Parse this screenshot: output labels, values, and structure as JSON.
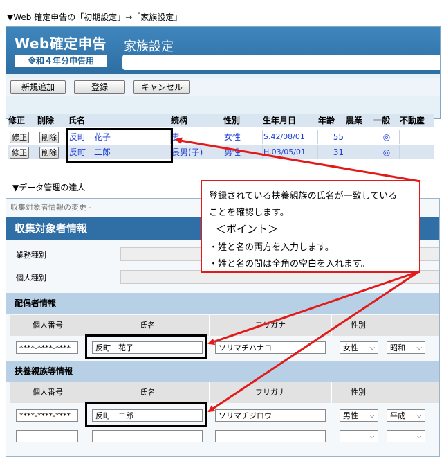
{
  "captions": {
    "top": "▼Web 確定申告の「初期設定」→「家族設定」",
    "middle": "▼データ管理の達人"
  },
  "web": {
    "logo_title": "Web確定申告",
    "logo_year": "令和４年分申告用",
    "page_heading": "家族設定",
    "toolbar": {
      "new_label": "新規追加",
      "register_label": "登録",
      "cancel_label": "キャンセル"
    },
    "table": {
      "headers": [
        "修正",
        "削除",
        "氏名",
        "続柄",
        "性別",
        "生年月日",
        "年齢",
        "農業",
        "一般",
        "不動産"
      ],
      "rows": [
        {
          "edit": "修正",
          "delete": "削除",
          "name": "反町　花子",
          "relation": "妻",
          "gender": "女性",
          "birth": "S.42/08/01",
          "age": "55",
          "farm": "",
          "general": "◎",
          "realestate": ""
        },
        {
          "edit": "修正",
          "delete": "削除",
          "name": "反町　二郎",
          "relation": "長男(子)",
          "gender": "男性",
          "birth": "H.03/05/01",
          "age": "31",
          "farm": "",
          "general": "◎",
          "realestate": ""
        }
      ]
    }
  },
  "callout": {
    "line1": "登録されている扶養親族の氏名が一致している",
    "line2": "ことを確認します。",
    "point": "＜ポイント＞",
    "bullet1": "・姓と名の両方を入力します。",
    "bullet2": "・姓と名の間は全角の空白を入れます。"
  },
  "dm": {
    "topline": "収集対象者情報の変更 -",
    "title": "収集対象者情報",
    "field1": "業務種別",
    "field2": "個人種別",
    "spouse_section": "配偶者情報",
    "dependent_section": "扶養親族等情報",
    "col_headers": [
      "個人番号",
      "氏名",
      "フリガナ",
      "性別"
    ],
    "spouse": {
      "number": "****-****-****",
      "name": "反町　花子",
      "kana": "ソリマチハナコ",
      "gender": "女性",
      "era": "昭和"
    },
    "dependent": {
      "number": "****-****-****",
      "name": "反町　二郎",
      "kana": "ソリマチジロウ",
      "gender": "男性",
      "era": "平成"
    }
  },
  "colors": {
    "accent_blue": "#2f6fa6",
    "callout_red": "#e21a1a"
  }
}
